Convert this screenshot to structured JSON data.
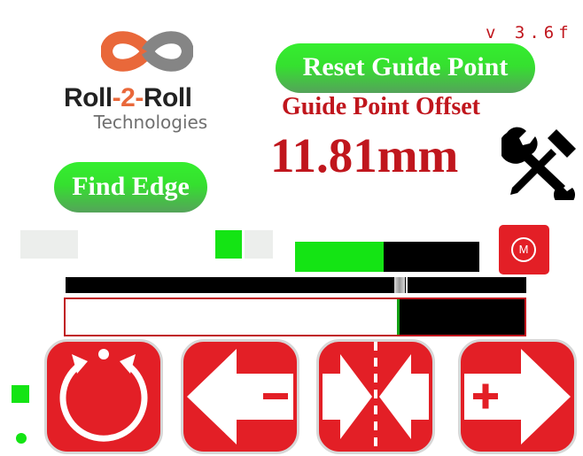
{
  "version": "v 3.6f",
  "logo": {
    "line1_a": "Roll",
    "line1_dash1": "-",
    "line1_b": "2",
    "line1_dash2": "-",
    "line1_c": "Roll",
    "line2": "Technologies"
  },
  "buttons": {
    "reset_guide_point": "Reset Guide Point",
    "find_edge": "Find Edge"
  },
  "guide_point_offset": {
    "label": "Guide Point Offset",
    "value": "11.81mm"
  },
  "indicators": {
    "left_squares": [
      "inactive",
      "inactive"
    ],
    "mid_squares": [
      "active",
      "inactive"
    ],
    "bottom_square": "active",
    "bottom_dot": "active"
  },
  "bars": {
    "level_fraction": 0.48,
    "slider_fraction": 0.725,
    "edge_fraction": 0.725
  },
  "motor_badge": "M",
  "icons": {
    "settings": "wrench-screwdriver-icon",
    "motor": "motor-icon",
    "auto": "circular-arrows-icon",
    "left": "left-arrow-minus-icon",
    "center": "center-arrows-icon",
    "right": "right-arrow-plus-icon"
  },
  "colors": {
    "accent_red": "#e31f26",
    "text_red": "#c0161d",
    "green": "#14e414"
  }
}
